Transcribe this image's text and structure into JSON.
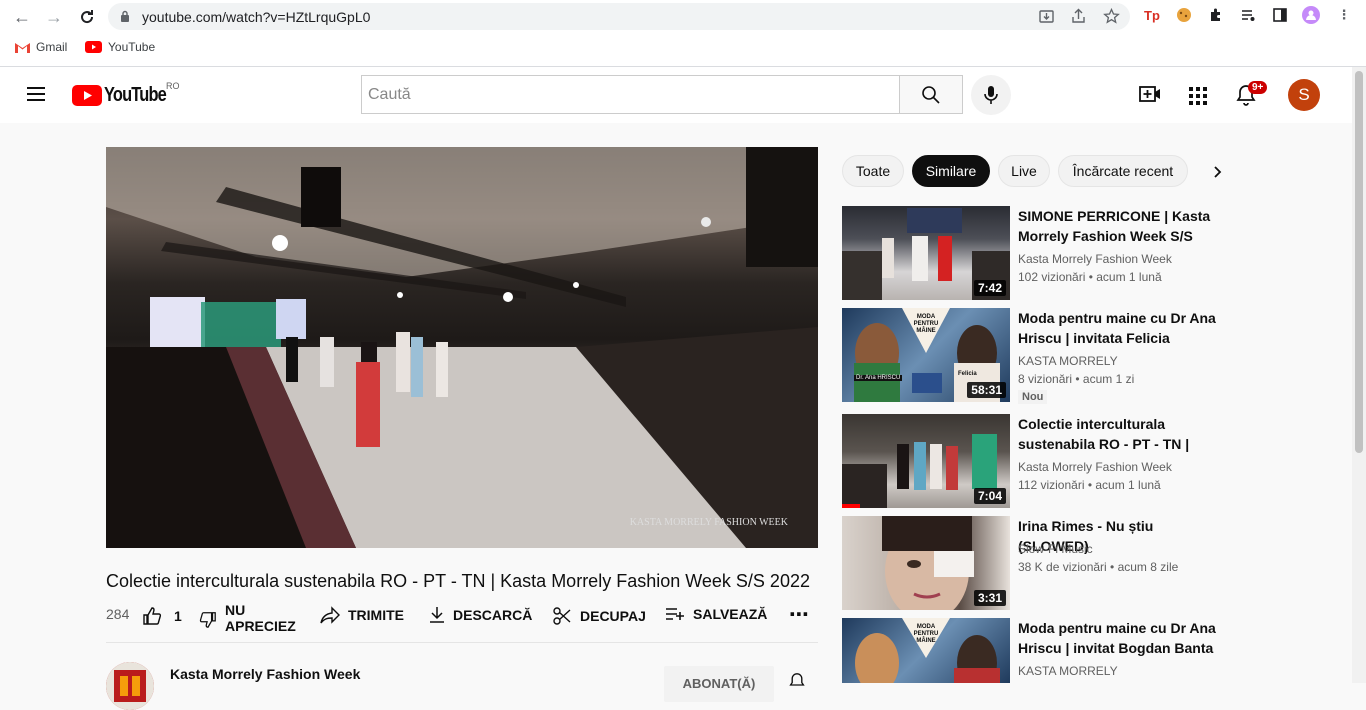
{
  "browser": {
    "url": "youtube.com/watch?v=HZtLrquGpL0",
    "bookmarks": [
      {
        "label": "Gmail"
      },
      {
        "label": "YouTube"
      }
    ],
    "ext_tp": "Tp"
  },
  "masthead": {
    "logo_text": "YouTube",
    "country": "RO",
    "search_placeholder": "Caută",
    "notif_count": "9+",
    "avatar_letter": "S",
    "avatar_color": "#c2410c"
  },
  "player": {
    "watermark": "KASTA MORRELY FASHION WEEK"
  },
  "video": {
    "title": "Colectie interculturala sustenabila RO - PT - TN | Kasta Morrely Fashion Week S/S 2022",
    "views_short": "284",
    "likes": "1",
    "dislike_label_1": "NU",
    "dislike_label_2": "APRECIEZ",
    "share_label": "TRIMITE",
    "download_label": "DESCARCĂ",
    "clip_label": "DECUPAJ",
    "save_label": "SALVEAZĂ",
    "channel": "Kasta Morrely Fashion Week",
    "subscribe_label": "ABONAT(Ă)"
  },
  "chips": [
    {
      "label": "Toate"
    },
    {
      "label": "Similare"
    },
    {
      "label": "Live"
    },
    {
      "label": "Încărcate recent"
    }
  ],
  "recommendations": [
    {
      "title": "SIMONE PERRICONE | Kasta Morrely Fashion Week S/S 2022",
      "channel": "Kasta Morrely Fashion Week",
      "meta": "102 vizionări • acum 1 lună",
      "duration": "7:42"
    },
    {
      "title": "Moda pentru maine cu Dr Ana Hriscu | invitata Felicia Purice…",
      "channel": "KASTA MORRELY",
      "meta": "8 vizionări • acum 1 zi",
      "duration": "58:31",
      "badge": "Nou",
      "thumb_text_1": "MODA PENTRU MÂINE",
      "thumb_text_2": "Dr. Ana HRISCU",
      "thumb_text_3": "Felicia"
    },
    {
      "title": "Colectie interculturala sustenabila RO - PT - TN | Kast…",
      "channel": "Kasta Morrely Fashion Week",
      "meta": "112 vizionări • acum 1 lună",
      "duration": "7:04"
    },
    {
      "title": "Irina Rimes - Nu știu (SLOWED)",
      "channel": "Slow-Fi Music",
      "meta": "38 K de vizionări • acum 8 zile",
      "duration": "3:31"
    },
    {
      "title": "Moda pentru maine cu Dr Ana Hriscu | invitat Bogdan Banta",
      "channel": "KASTA MORRELY",
      "thumb_text_1": "MODA PENTRU MÂINE"
    }
  ]
}
